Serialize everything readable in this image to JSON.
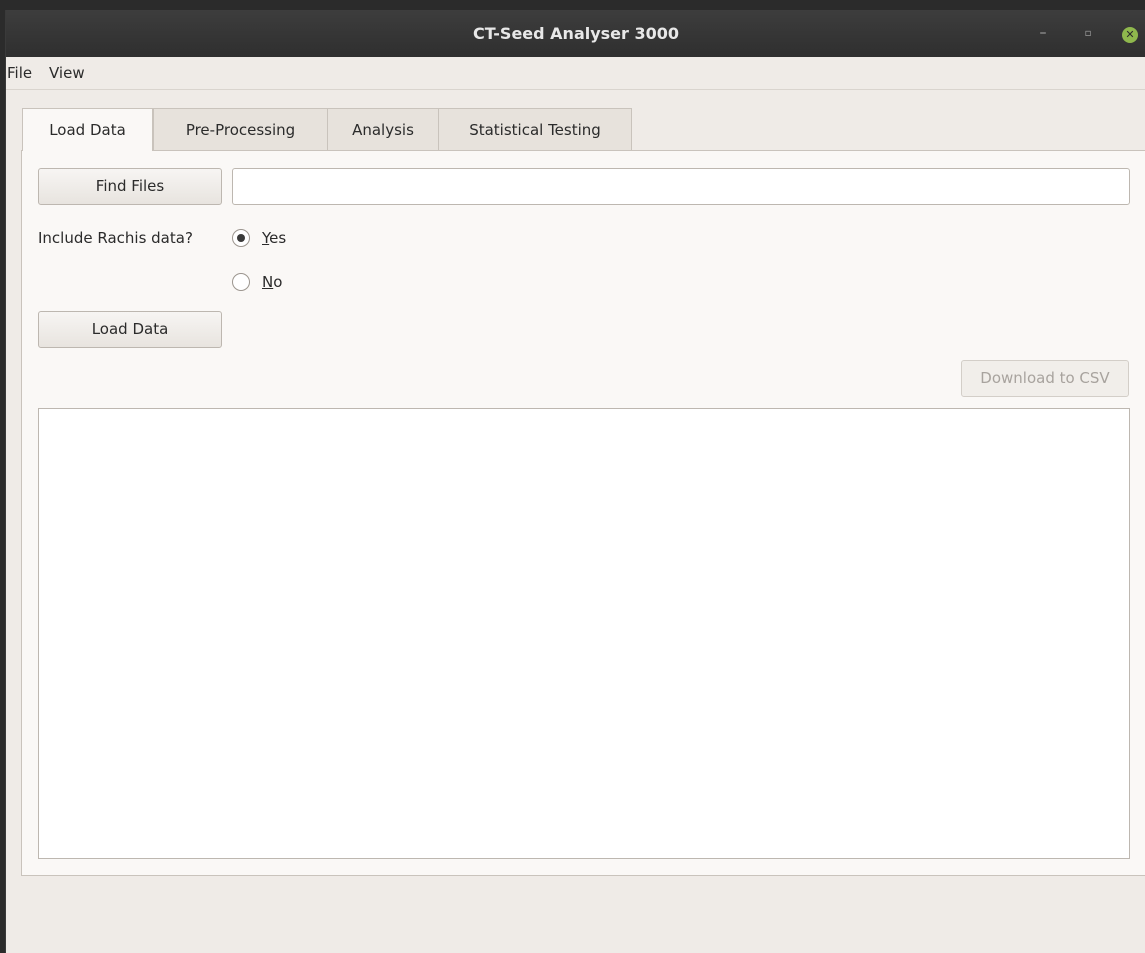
{
  "window": {
    "title": "CT-Seed Analyser 3000",
    "controls": {
      "minimize": "–",
      "maximize": "▫",
      "close": "✕"
    }
  },
  "menu": {
    "file": "File",
    "view": "View"
  },
  "tabs": [
    {
      "label": "Load Data",
      "active": true
    },
    {
      "label": "Pre-Processing",
      "active": false
    },
    {
      "label": "Analysis",
      "active": false
    },
    {
      "label": "Statistical Testing",
      "active": false
    }
  ],
  "load_data": {
    "find_files_label": "Find Files",
    "path_value": "",
    "rachis_question": "Include Rachis data?",
    "option_yes": "Yes",
    "option_no": "No",
    "selected_option": "Yes",
    "load_button_label": "Load Data",
    "download_csv_label": "Download to CSV",
    "download_enabled": false
  },
  "colors": {
    "titlebar": "#2f2f2f",
    "window_bg": "#efebe7",
    "panel_bg": "#faf8f6",
    "close_button": "#8fb84d"
  }
}
